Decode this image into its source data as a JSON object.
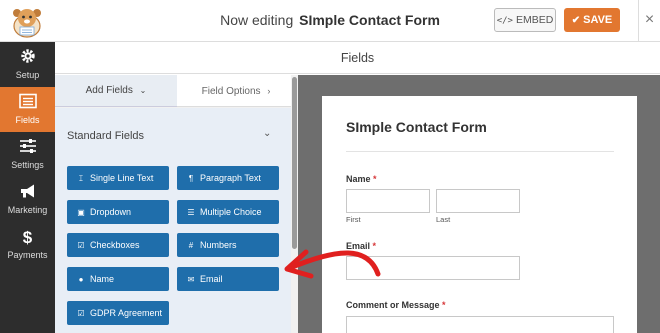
{
  "header": {
    "editing_prefix": "Now editing",
    "form_name": "SImple Contact Form",
    "embed_label": "EMBED",
    "save_label": "SAVE",
    "close_symbol": "×"
  },
  "nav": {
    "items": [
      {
        "label": "Setup",
        "icon": "gear-icon"
      },
      {
        "label": "Fields",
        "icon": "list-icon",
        "active": true
      },
      {
        "label": "Settings",
        "icon": "sliders-icon"
      },
      {
        "label": "Marketing",
        "icon": "megaphone-icon"
      },
      {
        "label": "Payments",
        "icon": "dollar-icon"
      }
    ]
  },
  "panel": {
    "title": "Fields",
    "tabs": {
      "add": "Add Fields",
      "options": "Field Options"
    },
    "standard_title": "Standard Fields",
    "standard_fields": [
      {
        "label": "Single Line Text",
        "icon": "text-cursor-icon"
      },
      {
        "label": "Paragraph Text",
        "icon": "paragraph-icon"
      },
      {
        "label": "Dropdown",
        "icon": "dropdown-icon"
      },
      {
        "label": "Multiple Choice",
        "icon": "list-bullets-icon"
      },
      {
        "label": "Checkboxes",
        "icon": "checkbox-icon"
      },
      {
        "label": "Numbers",
        "icon": "hash-icon"
      },
      {
        "label": "Name",
        "icon": "user-icon"
      },
      {
        "label": "Email",
        "icon": "envelope-icon"
      },
      {
        "label": "GDPR Agreement",
        "icon": "checkbox-icon"
      }
    ]
  },
  "preview": {
    "form_title": "SImple Contact Form",
    "fields": {
      "name_label": "Name",
      "required_mark": "*",
      "first_sublabel": "First",
      "last_sublabel": "Last",
      "email_label": "Email",
      "comment_label": "Comment or Message"
    }
  },
  "colors": {
    "accent_orange": "#e27730",
    "field_button_blue": "#1f6eab",
    "nav_dark": "#2d2d2d",
    "annotation_arrow": "#e0201f"
  }
}
